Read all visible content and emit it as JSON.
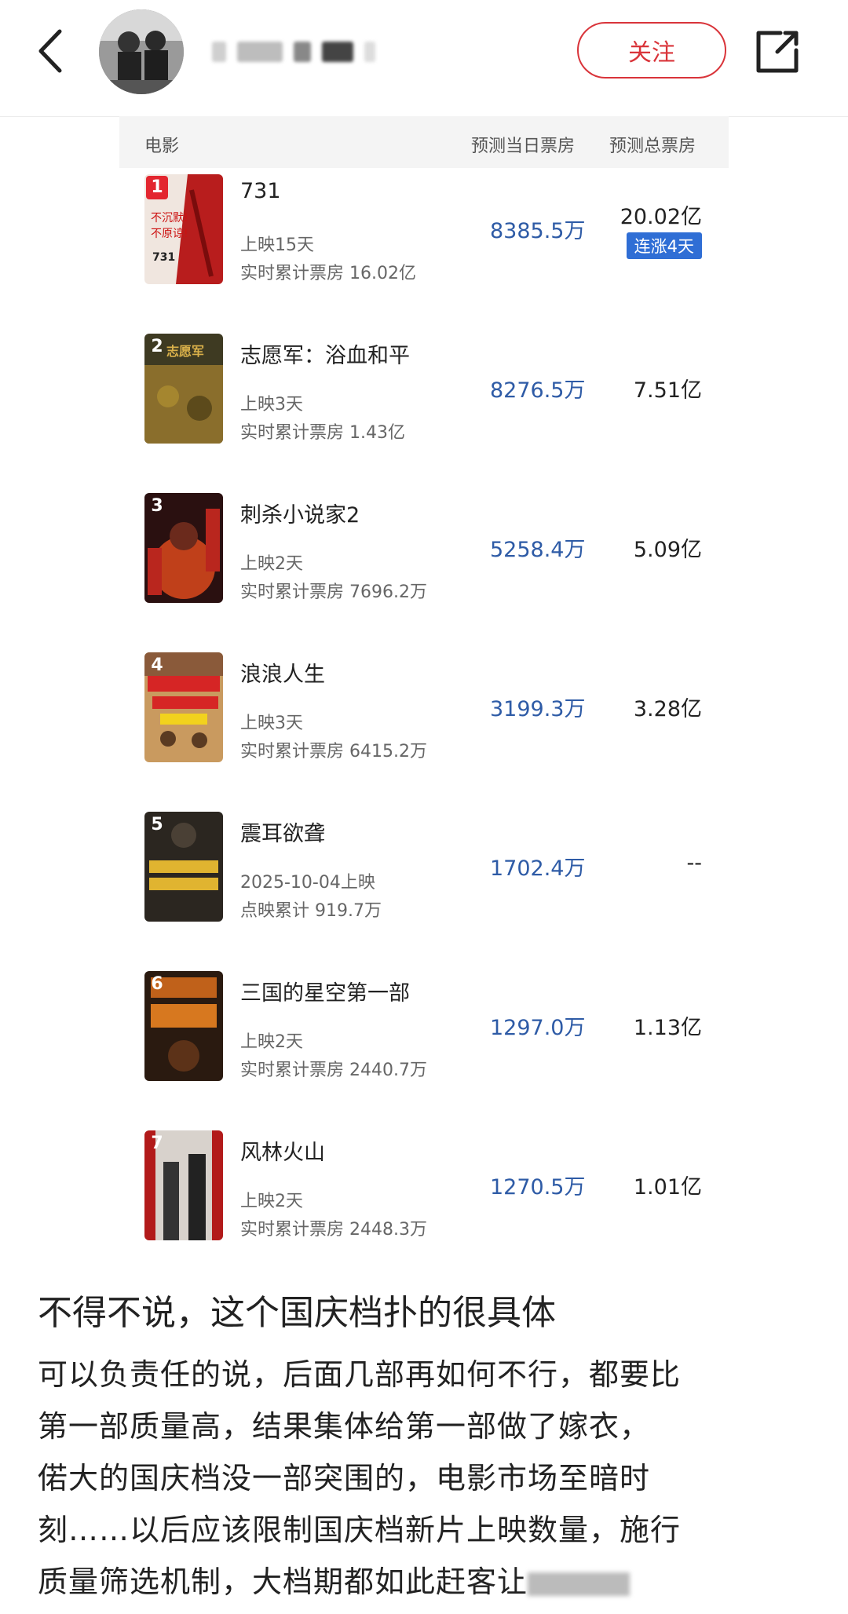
{
  "header": {
    "follow_label": "关注"
  },
  "table": {
    "col_movie": "电影",
    "col_daily": "预测当日票房",
    "col_total": "预测总票房"
  },
  "rows": [
    {
      "rank": "1",
      "title": "731",
      "meta1": "上映15天",
      "meta2": "实时累计票房 16.02亿",
      "daily": "8385.5万",
      "total": "20.02亿",
      "badge": "连涨4天"
    },
    {
      "rank": "2",
      "title": "志愿军：浴血和平",
      "meta1": "上映3天",
      "meta2": "实时累计票房 1.43亿",
      "daily": "8276.5万",
      "total": "7.51亿"
    },
    {
      "rank": "3",
      "title": "刺杀小说家2",
      "meta1": "上映2天",
      "meta2": "实时累计票房 7696.2万",
      "daily": "5258.4万",
      "total": "5.09亿"
    },
    {
      "rank": "4",
      "title": "浪浪人生",
      "meta1": "上映3天",
      "meta2": "实时累计票房 6415.2万",
      "daily": "3199.3万",
      "total": "3.28亿"
    },
    {
      "rank": "5",
      "title": "震耳欲聋",
      "meta1": "2025-10-04上映",
      "meta2": "点映累计 919.7万",
      "daily": "1702.4万",
      "total": "--"
    },
    {
      "rank": "6",
      "title": "三国的星空第一部",
      "meta1": "上映2天",
      "meta2": "实时累计票房 2440.7万",
      "daily": "1297.0万",
      "total": "1.13亿"
    },
    {
      "rank": "7",
      "title": "风林火山",
      "meta1": "上映2天",
      "meta2": "实时累计票房 2448.3万",
      "daily": "1270.5万",
      "total": "1.01亿"
    }
  ],
  "article": {
    "title": "不得不说，这个国庆档扑的很具体",
    "line1": "可以负责任的说，后面几部再如何不行，都要比",
    "line2": "第一部质量高，结果集体给第一部做了嫁衣，",
    "line3": "偌大的国庆档没一部突围的，电影市场至暗时",
    "line4": "刻……以后应该限制国庆档新片上映数量，施行",
    "line5": "质量筛选机制，大档期都如此赶客让"
  },
  "colors": {
    "accent_red": "#d9343a",
    "daily_blue": "#2e5ba6",
    "badge_blue": "#2f6ed5"
  }
}
